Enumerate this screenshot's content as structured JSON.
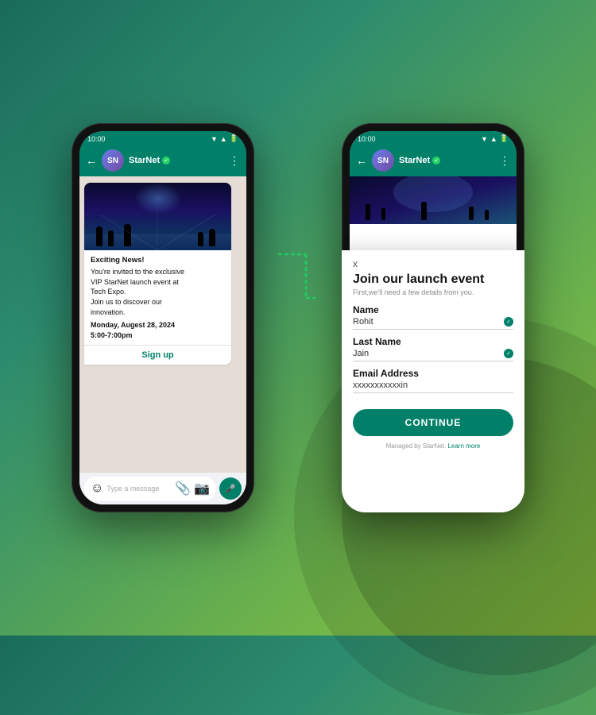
{
  "background": {
    "gradient_start": "#1a6b5a",
    "gradient_end": "#8dc63f"
  },
  "phone_left": {
    "status_bar": {
      "time": "10:00",
      "signal": "▼ ▲",
      "battery": "■"
    },
    "header": {
      "app_name": "StarNet",
      "verified": true,
      "back_icon": "←"
    },
    "message": {
      "title": "Exciting News!",
      "body_line1": "You're invited to the exclusive",
      "body_line2": "VIP StarNet launch event at",
      "body_line3": "Tech Expo.",
      "body_line4": "Join us to discover our",
      "body_line5": "innovation.",
      "date": "Monday, Augest 28, 2024",
      "time": "5:00-7:00pm"
    },
    "sign_up_button": "Sign up",
    "input_placeholder": "Type a message"
  },
  "phone_right": {
    "status_bar": {
      "time": "10:00"
    },
    "header": {
      "app_name": "StarNet",
      "verified": true,
      "back_icon": "←"
    },
    "form": {
      "close_icon": "x",
      "title": "Join our launch event",
      "subtitle": "First,we'll need a few details from you.",
      "fields": [
        {
          "label": "Name",
          "value": "Rohit",
          "filled": true
        },
        {
          "label": "Last Name",
          "value": "Jain",
          "filled": true
        },
        {
          "label": "Email Address",
          "value": "xxxxxxxxxxxin",
          "filled": false
        }
      ],
      "continue_button": "CONTINUE",
      "footer_text": "Managed by StarNet.",
      "footer_link": "Learn more"
    }
  },
  "connector": {
    "color": "#25d366"
  }
}
